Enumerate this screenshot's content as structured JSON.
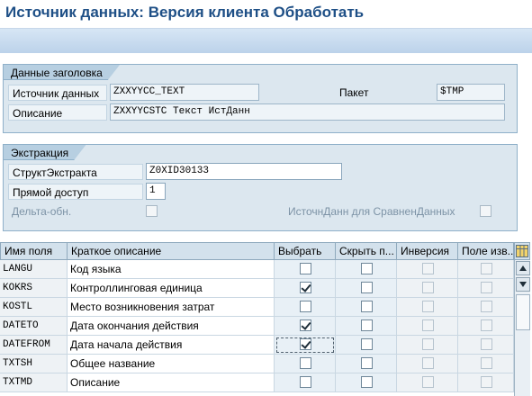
{
  "window": {
    "title": "Источник данных: Версия клиента Обработать"
  },
  "header_group": {
    "title": "Данные заголовка",
    "datasource_label": "Источник данных",
    "datasource_value": "ZXXYYCC_TEXT",
    "package_label": "Пакет",
    "package_value": "$TMP",
    "description_label": "Описание",
    "description_value": "ZXXYYCSTC Текст ИстДанн"
  },
  "extraction_group": {
    "title": "Экстракция",
    "extract_struct_label": "СтруктЭкстракта",
    "extract_struct_value": "Z0XID30133",
    "direct_access_label": "Прямой доступ",
    "direct_access_value": "1",
    "delta_label": "Дельта-обн.",
    "compare_label": "ИсточнДанн для СравненДанных"
  },
  "fields_table": {
    "columns": [
      "Имя поля",
      "Краткое описание",
      "Выбрать",
      "Скрыть п...",
      "Инверсия",
      "Поле изв..."
    ],
    "rows": [
      {
        "name": "LANGU",
        "desc": "Код языка",
        "select": false
      },
      {
        "name": "KOKRS",
        "desc": "Контроллинговая единица",
        "select": true
      },
      {
        "name": "KOSTL",
        "desc": "Место возникновения затрат",
        "select": false
      },
      {
        "name": "DATETO",
        "desc": "Дата окончания действия",
        "select": true
      },
      {
        "name": "DATEFROM",
        "desc": "Дата начала действия",
        "select": true
      },
      {
        "name": "TXTSH",
        "desc": "Общее название",
        "select": false
      },
      {
        "name": "TXTMD",
        "desc": "Описание",
        "select": false
      }
    ]
  },
  "icons": {
    "table_settings": "table-settings-icon",
    "scroll_up": "arrow-up-icon",
    "scroll_down": "arrow-down-icon"
  },
  "colors": {
    "title_text": "#1e4f86",
    "group_background": "#dce7ef",
    "toolbar": "#bcd2ea"
  }
}
